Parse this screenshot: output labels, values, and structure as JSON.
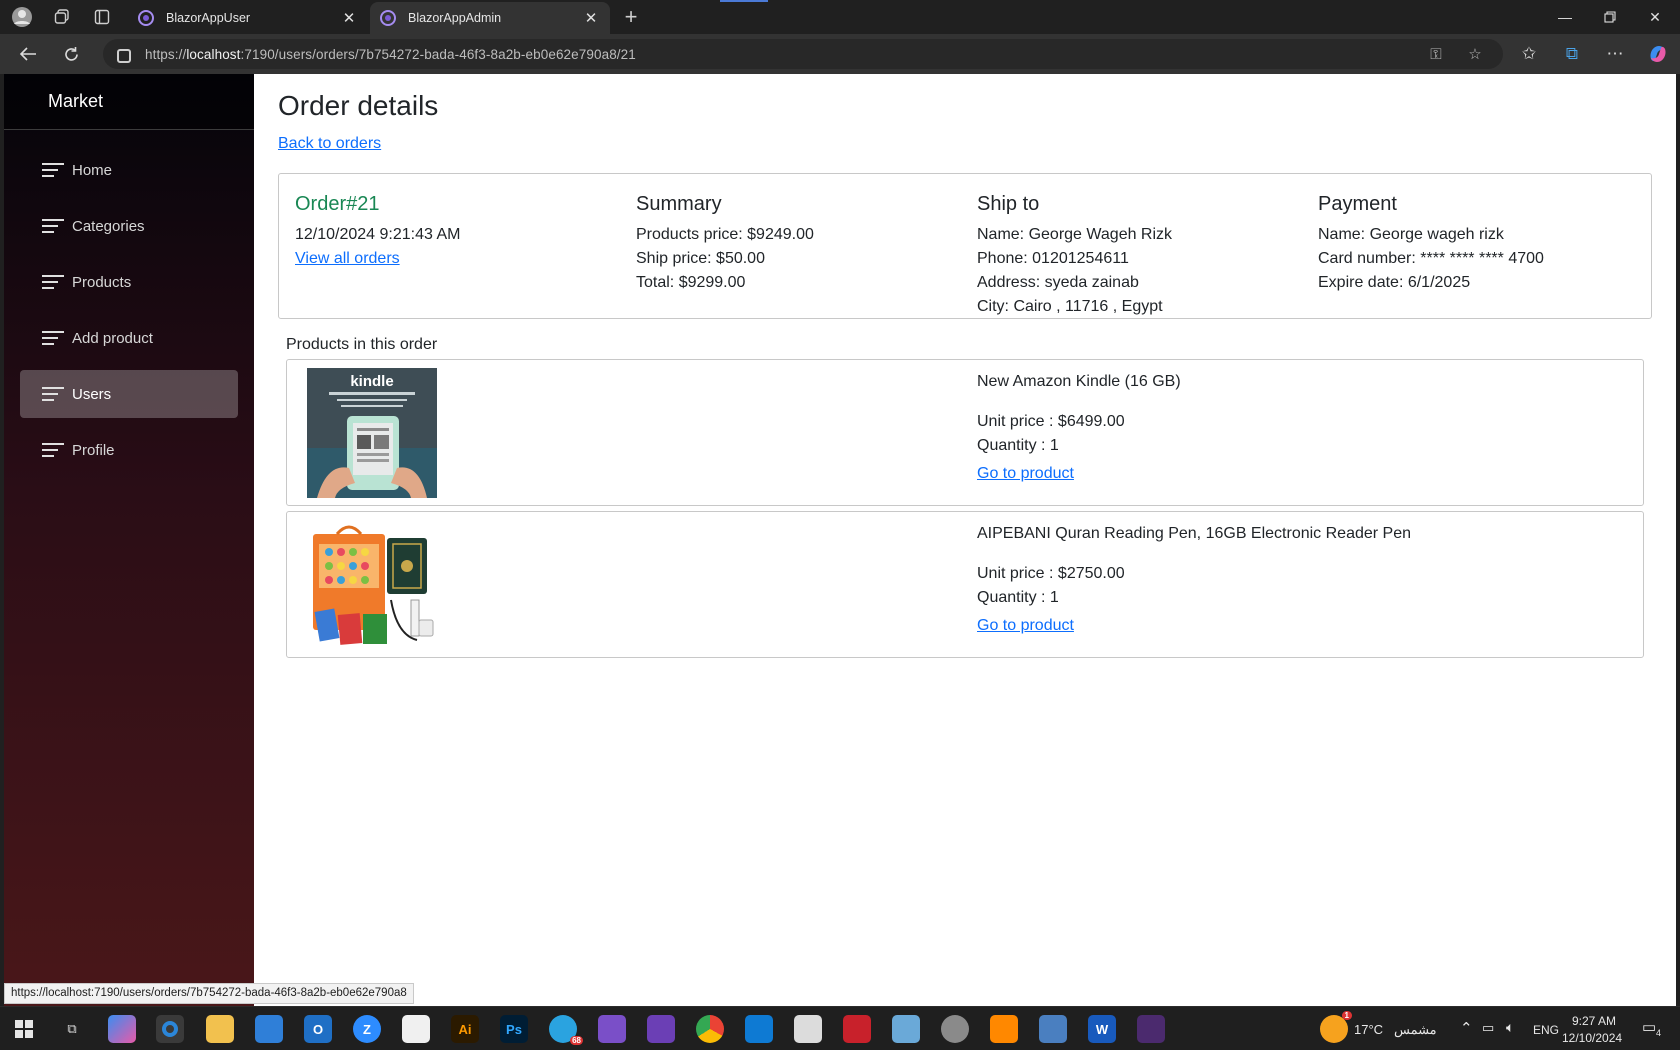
{
  "browser": {
    "tabs": [
      {
        "title": "BlazorAppUser",
        "active": false
      },
      {
        "title": "BlazorAppAdmin",
        "active": true
      }
    ],
    "url_prefix": "https://",
    "url_host": "localhost",
    "url_rest": ":7190/users/orders/7b754272-bada-46f3-8a2b-eb0e62e790a8/21",
    "status_url": "https://localhost:7190/users/orders/7b754272-bada-46f3-8a2b-eb0e62e790a8"
  },
  "sidebar": {
    "brand": "Market",
    "items": [
      {
        "label": "Home",
        "active": false
      },
      {
        "label": "Categories",
        "active": false
      },
      {
        "label": "Products",
        "active": false
      },
      {
        "label": "Add product",
        "active": false
      },
      {
        "label": "Users",
        "active": true
      },
      {
        "label": "Profile",
        "active": false
      }
    ]
  },
  "page": {
    "title": "Order details",
    "back_link": "Back to orders",
    "order": {
      "heading": "Order#21",
      "date": "12/10/2024 9:21:43 AM",
      "view_all": "View all orders"
    },
    "summary": {
      "heading": "Summary",
      "products_price": "Products price: $9249.00",
      "ship_price": "Ship price: $50.00",
      "total": "Total: $9299.00"
    },
    "ship_to": {
      "heading": "Ship to",
      "name": "Name: George Wageh Rizk",
      "phone": "Phone: 01201254611",
      "address": "Address: syeda zainab",
      "city": "City: Cairo , 11716 , Egypt"
    },
    "payment": {
      "heading": "Payment",
      "name": "Name: George wageh rizk",
      "card": "Card number: **** **** **** 4700",
      "expire": "Expire date: 6/1/2025"
    },
    "products_label": "Products in this order",
    "products": [
      {
        "name": "New Amazon Kindle (16 GB)",
        "unit_price": "Unit price : $6499.00",
        "quantity": "Quantity : 1",
        "link": "Go to product",
        "image_text": "kindle"
      },
      {
        "name": "AIPEBANI Quran Reading Pen, 16GB Electronic Reader Pen",
        "unit_price": "Unit price : $2750.00",
        "quantity": "Quantity : 1",
        "link": "Go to product"
      }
    ]
  },
  "taskbar": {
    "weather": "17°C",
    "weather_label": "مشمس",
    "weather_badge": "1",
    "lang": "ENG",
    "time": "9:27 AM",
    "date": "12/10/2024",
    "notifications": "4",
    "telegram_badge": "68"
  }
}
